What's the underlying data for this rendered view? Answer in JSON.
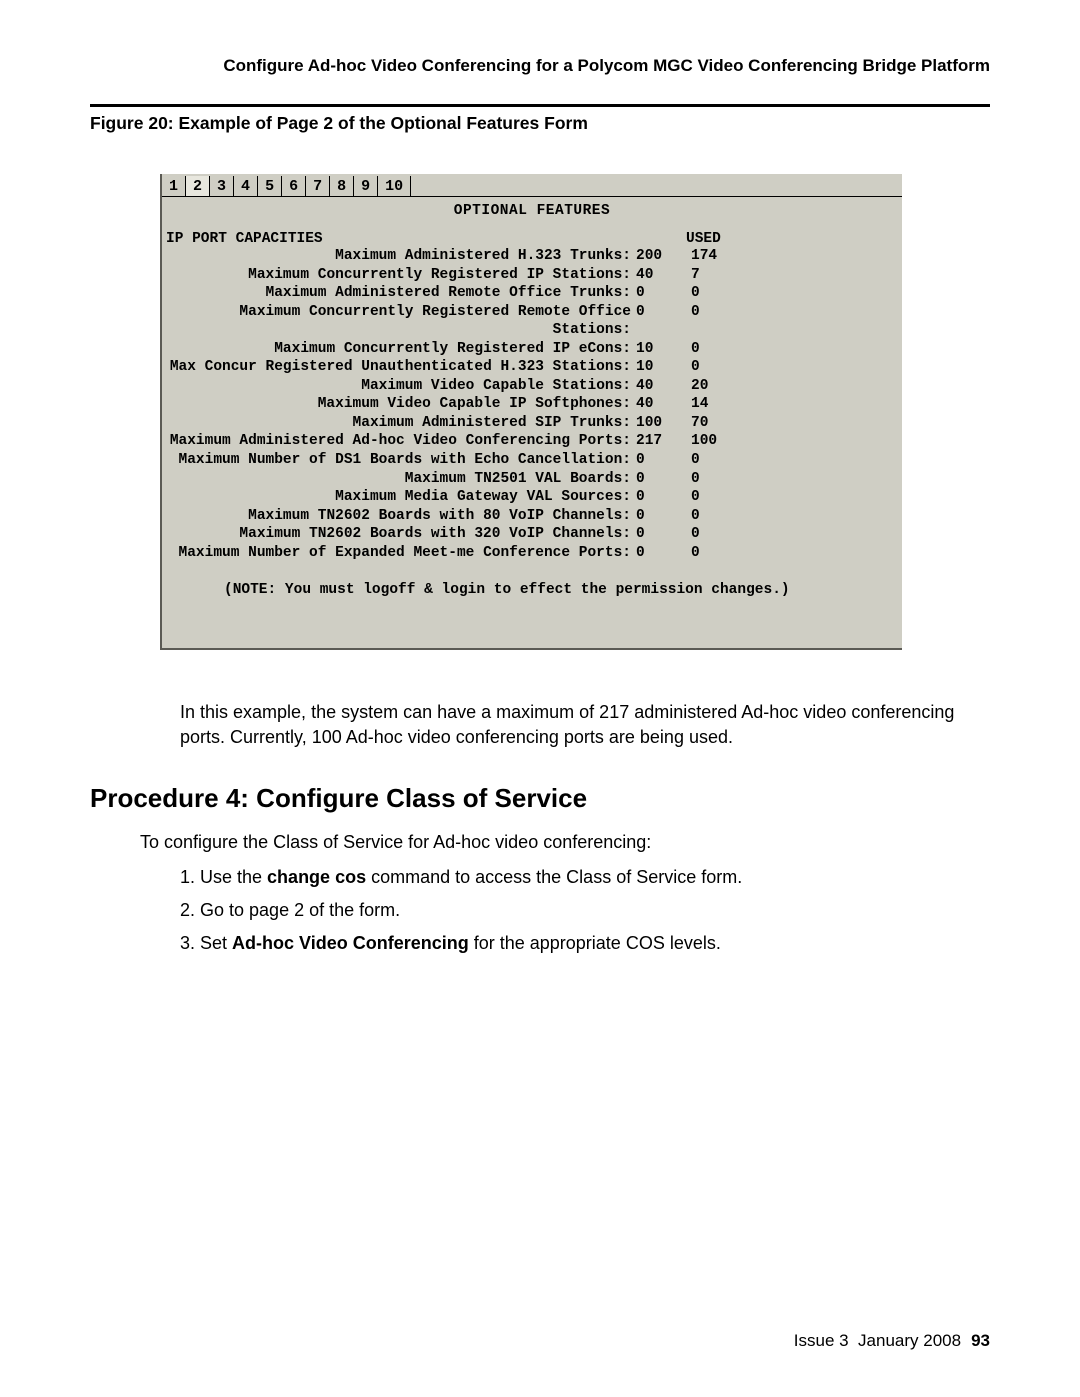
{
  "header": {
    "title": "Configure Ad-hoc Video Conferencing for a Polycom MGC Video Conferencing Bridge Platform"
  },
  "figure": {
    "caption": "Figure 20: Example of Page 2 of the Optional Features Form"
  },
  "terminal": {
    "tabs": [
      "1",
      "2",
      "3",
      "4",
      "5",
      "6",
      "7",
      "8",
      "9",
      "10"
    ],
    "active_tab_index": 1,
    "title": "OPTIONAL FEATURES",
    "section_label": "IP PORT CAPACITIES",
    "used_label": "USED",
    "rows": [
      {
        "label": "Maximum Administered H.323 Trunks:",
        "value": "200",
        "used": "174"
      },
      {
        "label": "Maximum Concurrently Registered IP Stations:",
        "value": "40",
        "used": "7"
      },
      {
        "label": "Maximum Administered Remote Office Trunks:",
        "value": "0",
        "used": "0"
      },
      {
        "label": "Maximum Concurrently Registered Remote Office Stations:",
        "value": "0",
        "used": "0"
      },
      {
        "label": "Maximum Concurrently Registered IP eCons:",
        "value": "10",
        "used": "0"
      },
      {
        "label": "Max Concur Registered Unauthenticated H.323 Stations:",
        "value": "10",
        "used": "0"
      },
      {
        "label": "Maximum Video Capable Stations:",
        "value": "40",
        "used": "20"
      },
      {
        "label": "Maximum Video Capable IP Softphones:",
        "value": "40",
        "used": "14"
      },
      {
        "label": "Maximum Administered SIP Trunks:",
        "value": "100",
        "used": "70"
      },
      {
        "label": "Maximum Administered Ad-hoc Video Conferencing Ports:",
        "value": "217",
        "used": "100"
      },
      {
        "label": "Maximum Number of DS1 Boards with Echo Cancellation:",
        "value": "0",
        "used": "0"
      },
      {
        "label": "Maximum TN2501 VAL Boards:",
        "value": "0",
        "used": "0"
      },
      {
        "label": "Maximum Media Gateway VAL Sources:",
        "value": "0",
        "used": "0"
      },
      {
        "label": "Maximum TN2602 Boards with 80 VoIP Channels:",
        "value": "0",
        "used": "0"
      },
      {
        "label": "Maximum TN2602 Boards with 320 VoIP Channels:",
        "value": "0",
        "used": "0"
      },
      {
        "label": "Maximum Number of Expanded Meet-me Conference Ports:",
        "value": "0",
        "used": "0"
      }
    ],
    "note": "(NOTE: You must logoff & login to effect the permission changes.)"
  },
  "body": {
    "paragraph": "In this example, the system can have a maximum of 217 administered Ad-hoc video conferencing ports. Currently, 100 Ad-hoc video conferencing ports are being used.",
    "heading": "Procedure 4: Configure Class of Service",
    "intro": "To configure the Class of Service for Ad-hoc video conferencing:",
    "steps": {
      "s1_a": "1. Use the ",
      "s1_b": "change cos",
      "s1_c": " command to access the Class of Service form.",
      "s2": "2. Go to page 2 of the form.",
      "s3_a": "3. Set ",
      "s3_b": "Ad-hoc Video Conferencing",
      "s3_c": " for the appropriate COS levels."
    }
  },
  "footer": {
    "issue": "Issue 3",
    "date": "January 2008",
    "page": "93"
  }
}
